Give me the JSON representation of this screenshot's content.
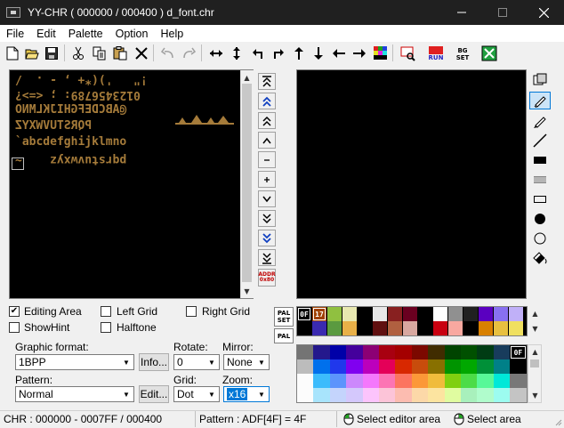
{
  "window": {
    "title": "YY-CHR ( 000000 / 000400 ) d_font.chr"
  },
  "menu": [
    "File",
    "Edit",
    "Palette",
    "Option",
    "Help"
  ],
  "font_rows": [
    " !\"   ')(*+ , - .  /",
    "0123456789: ; <=>?",
    "@ABCDEFGHIJKLMNO",
    "PQRSTUVWXYZ",
    "`abcdefghijklmno",
    "pqrstuvwxyz    ~"
  ],
  "nav_buttons": {
    "addr_top": "ADDR",
    "addr_bottom": "0x80"
  },
  "palette_buttons": {
    "pal_set_top": "PAL",
    "pal_set_bottom": "SET",
    "pal": "PAL"
  },
  "palette_row": {
    "labels": [
      "0F",
      "17"
    ],
    "colors": [
      "#000000",
      "#a04000",
      "#90c040",
      "#e8e8b0",
      "#000000",
      "#e8e8e8",
      "#882020",
      "#6a0020",
      "#000000",
      "#ffffff",
      "#909090",
      "#202020",
      "#5a00c0",
      "#8870f0",
      "#c0b0f8"
    ]
  },
  "palette_row2": [
    "#000000",
    "#3a2ab0",
    "#5a9a40",
    "#e8b048",
    "#000000",
    "#601010",
    "#b06040",
    "#d8a8a0",
    "#000000",
    "#c80010",
    "#f8a8a0",
    "#000000",
    "#d88000",
    "#e8c040",
    "#f0e060"
  ],
  "master_palette": {
    "selected_label": "0F",
    "rows": [
      [
        "#747474",
        "#24188c",
        "#0000a8",
        "#44009c",
        "#8c0074",
        "#a80010",
        "#a40000",
        "#7c0800",
        "#402c00",
        "#004400",
        "#005000",
        "#003c14",
        "#183c5c",
        "#000000"
      ],
      [
        "#bcbcbc",
        "#0070ec",
        "#2038ec",
        "#8000f0",
        "#bc00bc",
        "#e40058",
        "#d82800",
        "#c84c0c",
        "#887000",
        "#009400",
        "#00a800",
        "#009038",
        "#008088",
        "#000000"
      ],
      [
        "#fcfcfc",
        "#3cbcfc",
        "#5c94fc",
        "#cc88fc",
        "#f478fc",
        "#fc74b4",
        "#fc7460",
        "#fc9838",
        "#f0bc3c",
        "#80d010",
        "#4cdc48",
        "#58f898",
        "#00e8d8",
        "#787878"
      ],
      [
        "#fcfcfc",
        "#a8e4fc",
        "#c4d4fc",
        "#d4c8fc",
        "#fcc4fc",
        "#fcc4d8",
        "#fcbcb0",
        "#fcd8a8",
        "#fce4a0",
        "#e0fca0",
        "#a8f0bc",
        "#b0fccc",
        "#9cfcf0",
        "#c4c4c4"
      ]
    ]
  },
  "options": {
    "editing_area": "Editing Area",
    "left_grid": "Left Grid",
    "right_grid": "Right Grid",
    "show_hint": "ShowHint",
    "halftone": "Halftone",
    "editing_area_checked": "✔"
  },
  "labels": {
    "graphic_format": "Graphic format:",
    "rotate": "Rotate:",
    "mirror": "Mirror:",
    "pattern": "Pattern:",
    "grid": "Grid:",
    "zoom": "Zoom:"
  },
  "values": {
    "graphic_format": "1BPP",
    "rotate": "0",
    "mirror": "None",
    "pattern": "Normal",
    "grid": "Dot",
    "zoom": "x16"
  },
  "buttons": {
    "info": "Info...",
    "edit": "Edit..."
  },
  "status": {
    "chr": "CHR : 000000 - 0007FF / 000400",
    "pattern": "Pattern : ADF[4F] = 4F",
    "select_editor": "Select editor area",
    "select_area": "Select area"
  },
  "colors": {
    "font_glyph": "#a57b3a",
    "accent_blue": "#0078d7"
  }
}
